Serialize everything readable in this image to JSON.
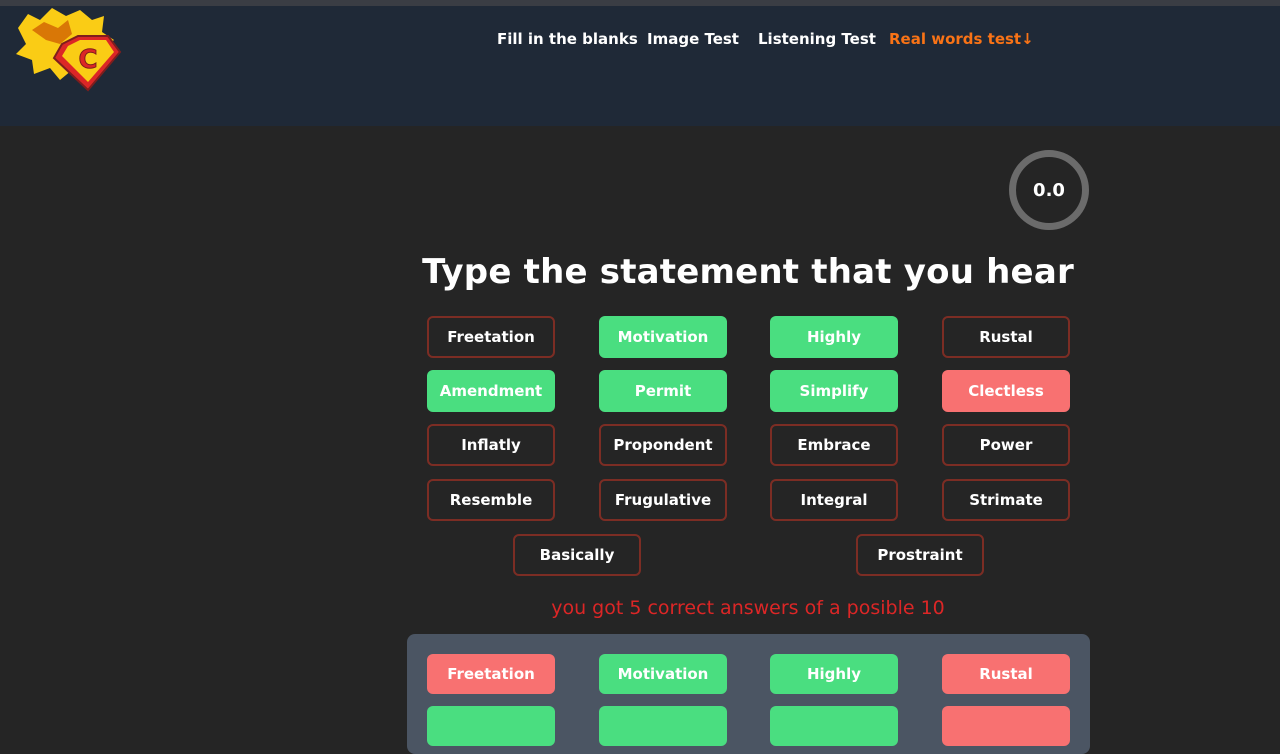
{
  "nav": {
    "items": [
      {
        "label": "Fill in the blanks"
      },
      {
        "label": "Image Test"
      },
      {
        "label": "Listening Test"
      },
      {
        "label": "Real words test↓"
      }
    ]
  },
  "logo": {
    "letter": "C"
  },
  "timer": {
    "value": "0.0"
  },
  "title": "Type the statement that you hear",
  "words": [
    {
      "label": "Freetation",
      "state": "outline"
    },
    {
      "label": "Motivation",
      "state": "green"
    },
    {
      "label": "Highly",
      "state": "green"
    },
    {
      "label": "Rustal",
      "state": "outline"
    },
    {
      "label": "Amendment",
      "state": "green"
    },
    {
      "label": "Permit",
      "state": "green"
    },
    {
      "label": "Simplify",
      "state": "green"
    },
    {
      "label": "Clectless",
      "state": "red"
    },
    {
      "label": "Inflatly",
      "state": "outline"
    },
    {
      "label": "Propondent",
      "state": "outline"
    },
    {
      "label": "Embrace",
      "state": "outline"
    },
    {
      "label": "Power",
      "state": "outline"
    },
    {
      "label": "Resemble",
      "state": "outline"
    },
    {
      "label": "Frugulative",
      "state": "outline"
    },
    {
      "label": "Integral",
      "state": "outline"
    },
    {
      "label": "Strimate",
      "state": "outline"
    },
    {
      "label": "Basically",
      "state": "outline"
    },
    {
      "label": "Prostraint",
      "state": "outline"
    }
  ],
  "result": "you got 5 correct answers of a posible 10",
  "results_panel": {
    "words": [
      {
        "label": "Freetation",
        "state": "red"
      },
      {
        "label": "Motivation",
        "state": "green"
      },
      {
        "label": "Highly",
        "state": "green"
      },
      {
        "label": "Rustal",
        "state": "red"
      },
      {
        "label": "",
        "state": "green"
      },
      {
        "label": "",
        "state": "green"
      },
      {
        "label": "",
        "state": "green"
      },
      {
        "label": "",
        "state": "red"
      }
    ]
  },
  "colors": {
    "header_bg": "#1f2937",
    "page_bg": "#252525",
    "accent": "#f97316",
    "correct": "#4ade80",
    "wrong": "#f87171",
    "outline": "#7c2d24",
    "result_text": "#dc2626"
  }
}
